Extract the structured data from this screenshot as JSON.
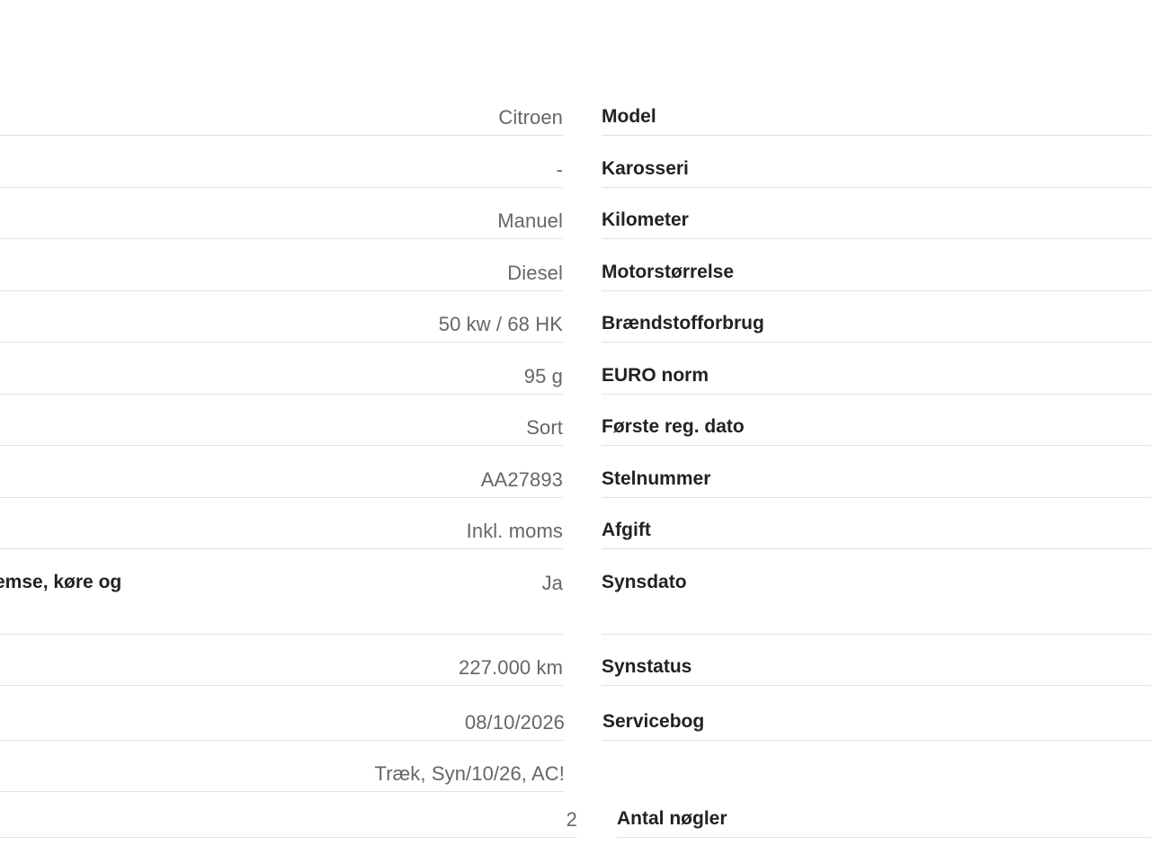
{
  "rows": [
    {
      "value": "Citroen",
      "label": "Model"
    },
    {
      "value": "-",
      "label": "Karosseri"
    },
    {
      "value": "Manuel",
      "label": "Kilometer"
    },
    {
      "value": "Diesel",
      "label": "Motorstørrelse"
    },
    {
      "value": "50 kw / 68 HK",
      "label": "Brændstofforbrug"
    },
    {
      "value": "95 g",
      "label": "EURO norm"
    },
    {
      "value": "Sort",
      "label": "Første reg. dato"
    },
    {
      "value": "AA27893",
      "label": "Stelnummer"
    },
    {
      "value": "Inkl. moms",
      "label": "Afgift"
    },
    {
      "value": "Ja",
      "label": "Synsdato",
      "left_label": "emse, køre og"
    },
    {
      "value": "227.000 km",
      "label": "Synstatus"
    },
    {
      "value": "08/10/2026",
      "label": "Servicebog"
    },
    {
      "value": "Træk, Syn/10/26, AC!",
      "label": ""
    },
    {
      "value": "2",
      "label": "Antal nøgler"
    }
  ]
}
